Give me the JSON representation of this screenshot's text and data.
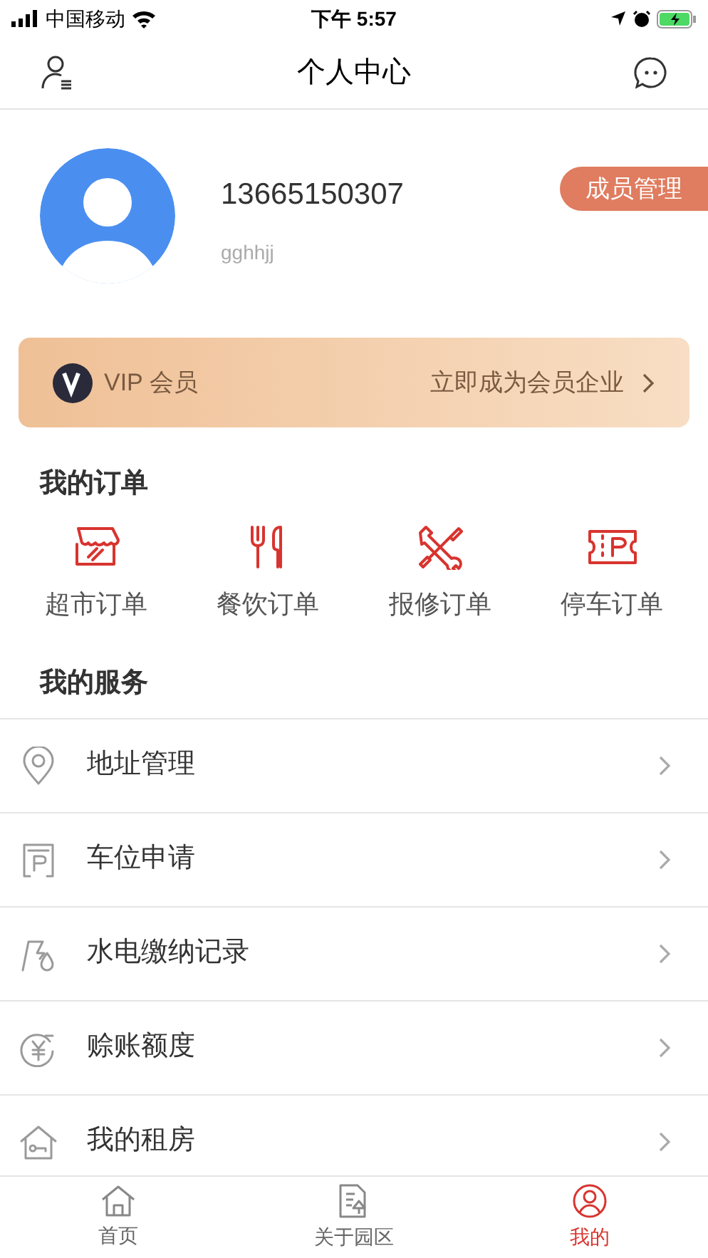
{
  "status_bar": {
    "carrier": "中国移动",
    "time": "下午 5:57"
  },
  "nav": {
    "title": "个人中心"
  },
  "profile": {
    "phone": "13665150307",
    "username": "gghhjj",
    "badge": "成员管理"
  },
  "vip": {
    "label": "VIP 会员",
    "action": "立即成为会员企业"
  },
  "orders": {
    "title": "我的订单",
    "items": [
      {
        "kind": "store",
        "label": "超市订单"
      },
      {
        "kind": "food",
        "label": "餐饮订单"
      },
      {
        "kind": "repair",
        "label": "报修订单"
      },
      {
        "kind": "parking",
        "label": "停车订单"
      }
    ]
  },
  "services": {
    "title": "我的服务",
    "items": [
      {
        "kind": "location",
        "label": "地址管理"
      },
      {
        "kind": "parking",
        "label": "车位申请"
      },
      {
        "kind": "utility",
        "label": "水电缴纳记录"
      },
      {
        "kind": "credit",
        "label": "赊账额度"
      },
      {
        "kind": "house",
        "label": "我的租房"
      }
    ]
  },
  "tab_bar": [
    {
      "kind": "home",
      "label": "首页",
      "selected": false
    },
    {
      "kind": "park",
      "label": "关于园区",
      "selected": false
    },
    {
      "kind": "me",
      "label": "我的",
      "selected": true
    }
  ]
}
